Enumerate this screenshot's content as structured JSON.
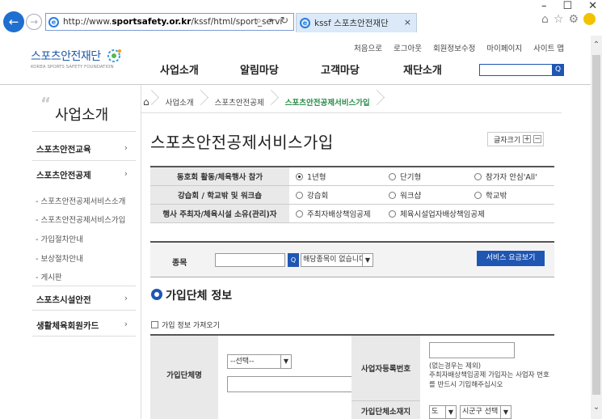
{
  "browser": {
    "url_prefix": "http://www.",
    "url_domain": "sportsafety.or.kr",
    "url_path": "/kssf/html/sport_servi",
    "search_glyph": "⌕",
    "dropdown_glyph": "▾",
    "refresh_glyph": "↻",
    "tab_title": "kssf 스포츠안전재단",
    "tab_close": "×",
    "minimize": "–",
    "maximize": "☐",
    "close": "✕",
    "back_glyph": "←",
    "forward_glyph": "→",
    "scroll_up": "⌃",
    "scroll_down": "⌄",
    "home_glyph": "⌂",
    "star_glyph": "☆",
    "gear_glyph": "⚙"
  },
  "site": {
    "util_links": [
      "처음으로",
      "로그아웃",
      "회원정보수정",
      "마이페이지",
      "사이트 맵"
    ],
    "logo_text": "스포츠안전재단",
    "logo_sub": "KOREA SPORTS SAFETY FOUNDATION",
    "gnb": [
      "사업소개",
      "알림마당",
      "고객마당",
      "재단소개"
    ],
    "search_btn": "Q"
  },
  "lnb": {
    "quote": "“",
    "title": "사업소개",
    "items": [
      {
        "label": "스포츠안전교육",
        "chev": "›"
      },
      {
        "label": "스포츠안전공제",
        "chev": "›"
      },
      {
        "label": "스포츠시설안전",
        "chev": "›"
      },
      {
        "label": "생활체육회원카드",
        "chev": "›"
      }
    ],
    "sub_items": [
      "- 스포츠안전공제서비스소개",
      "- 스포츠안전공제서비스가입",
      "- 가입절차안내",
      "- 보상절차안내",
      "- 게시판"
    ]
  },
  "breadcrumb": {
    "home": "⌂",
    "items": [
      "사업소개",
      "스포츠안전공제",
      "스포츠안전공제서비스가입"
    ]
  },
  "main": {
    "title": "스포츠안전공제서비스가입",
    "font_size_label": "글자크기",
    "font_plus": "+",
    "font_minus": "−"
  },
  "type_table": {
    "rows": [
      {
        "header": "동호회 활동/체육행사 참가",
        "options": [
          "1년형",
          "단기형",
          "참가자 안심'All'"
        ],
        "selected": 0
      },
      {
        "header": "강습회 / 학교밖 및 워크숍",
        "options": [
          "강습회",
          "워크샵",
          "학교밖"
        ],
        "selected": -1
      },
      {
        "header": "행사 주최자/체육시설 소유(관리)자",
        "options": [
          "주최자배상책임공제",
          "체육시설업자배상책임공제"
        ],
        "selected": -1
      }
    ]
  },
  "sport_search": {
    "label": "종목",
    "search_btn": "Q",
    "select_value": "해당종목이 없습니다.",
    "fee_button": "서비스 요금보기"
  },
  "section": {
    "title": "가입단체 정보",
    "import_label": "가입 정보 가져오기"
  },
  "group_table": {
    "name_header": "가입단체명",
    "name_select": "--선택--",
    "biz_header": "사업자등록번호",
    "biz_note1": "(없는경우는 제외)",
    "biz_note2": "주최자배상책임공제 가입자는 사업자 번호를 반드시 기입해주십시오",
    "addr_header": "가입단체소재지",
    "sido_value": "도",
    "sigungu_value": "시군구 선택"
  },
  "colors": {
    "accent": "#1f56b3",
    "breadcrumb_current": "#2a8a4a"
  }
}
